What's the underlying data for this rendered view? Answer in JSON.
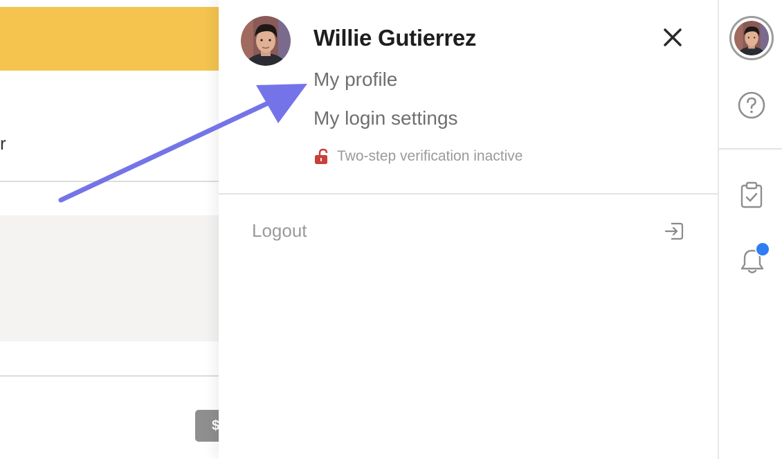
{
  "colors": {
    "banner": "#f4c44f",
    "accent_arrow": "#7474e8",
    "lock_red": "#c8403a",
    "notification_blue": "#2f7cf6",
    "bg_button": "#8f8f8f"
  },
  "background": {
    "label_fragment": "r",
    "button_fragment": "$"
  },
  "user_menu": {
    "user_name": "Willie Gutierrez",
    "avatar_icon": "user-avatar",
    "close_icon": "close-icon",
    "links": {
      "my_profile": "My profile",
      "login_settings": "My login settings"
    },
    "two_step": {
      "icon": "lock-open-icon",
      "text": "Two-step verification inactive"
    },
    "logout": {
      "label": "Logout",
      "icon": "logout-icon"
    }
  },
  "toolbar": {
    "icons": [
      "user-avatar",
      "help-icon",
      "clipboard-check-icon",
      "bell-icon"
    ],
    "notification_badge": true
  }
}
